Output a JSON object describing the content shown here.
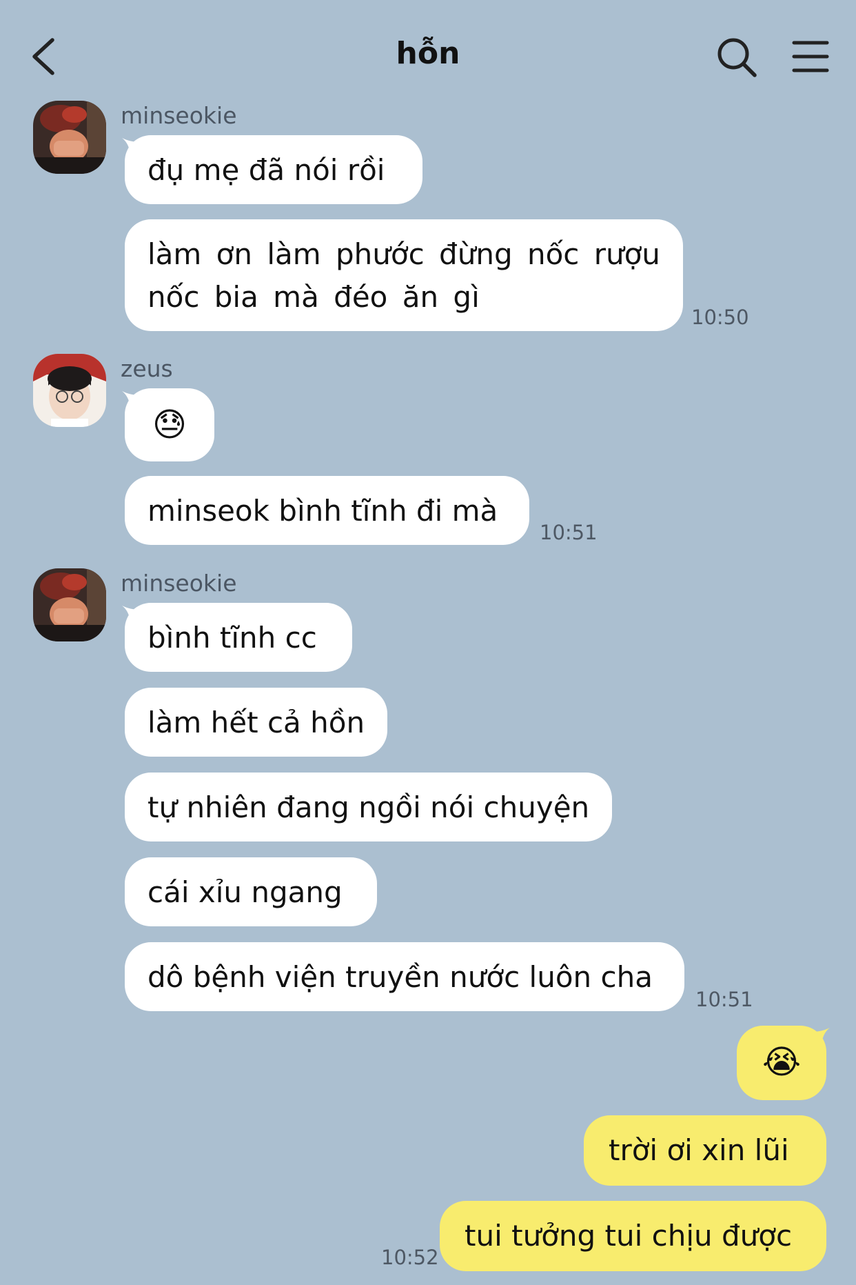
{
  "header": {
    "title": "hỗn",
    "back_icon": "chevron-left-icon",
    "search_icon": "search-icon",
    "menu_icon": "hamburger-menu-icon"
  },
  "colors": {
    "background": "#abbfd0",
    "incoming_bubble": "#ffffff",
    "outgoing_bubble": "#f8ec6e"
  },
  "groups": [
    {
      "sender": "minseokie",
      "messages": [
        "đụ mẹ đã nói rồi",
        "làm ơn làm phước đừng nốc rượu nốc bia mà đéo ăn gì"
      ],
      "time": "10:50"
    },
    {
      "sender": "zeus",
      "messages": [
        "😓",
        "minseok bình tĩnh đi mà"
      ],
      "time": "10:51"
    },
    {
      "sender": "minseokie",
      "messages": [
        "bình tĩnh cc",
        "làm hết cả hồn",
        "tự nhiên đang ngồi nói chuyện",
        "cái xỉu ngang",
        "dô bệnh viện truyền nước luôn cha"
      ],
      "time": "10:51"
    }
  ],
  "outgoing": {
    "messages": [
      "😭",
      "trời ơi xin lũi",
      "tui tưởng tui chịu được"
    ],
    "time": "10:52"
  }
}
